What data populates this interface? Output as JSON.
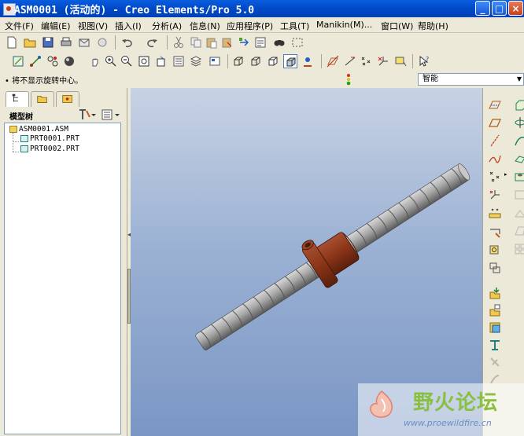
{
  "window": {
    "title": "ASM0001 (活动的) - Creo Elements/Pro 5.0",
    "minimize": "_",
    "maximize": "□",
    "close": "×"
  },
  "menus": [
    "文件(F)",
    "编辑(E)",
    "视图(V)",
    "插入(I)",
    "分析(A)",
    "信息(N)",
    "应用程序(P)",
    "工具(T)",
    "Manikin(M)...",
    "窗口(W)",
    "帮助(H)"
  ],
  "status": {
    "message": "• 将不显示旋转中心。",
    "filter": "智能"
  },
  "model_tree": {
    "title": "模型树",
    "items": [
      {
        "label": "ASM0001.ASM",
        "icon": "assembly-icon"
      },
      {
        "label": "PRT0001.PRT",
        "icon": "part-icon"
      },
      {
        "label": "PRT0002.PRT",
        "icon": "part-icon"
      }
    ]
  },
  "watermark": {
    "title": "野火论坛",
    "url": "www.proewildfire.cn"
  },
  "colors": {
    "titlebar": "#0049c7",
    "viewport_top": "#c8d2e4",
    "viewport_bottom": "#7a96c4",
    "screw": "#9a9a9a",
    "nut": "#8b3a20"
  }
}
